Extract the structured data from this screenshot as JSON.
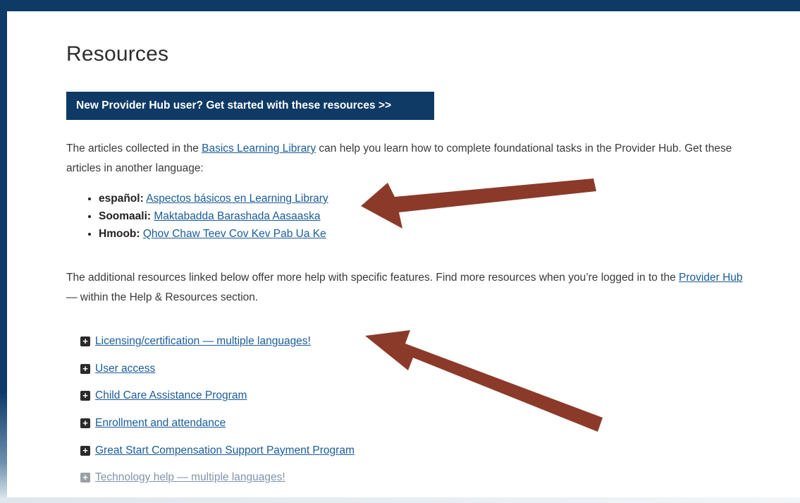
{
  "page": {
    "title": "Resources",
    "cta_label": "New Provider Hub user? Get started with these resources >>"
  },
  "intro": {
    "before_link": "The articles collected in the ",
    "link_text": "Basics Learning Library",
    "after_link": " can help you learn how to complete foundational tasks in the Provider Hub. Get these articles in another language:"
  },
  "languages": [
    {
      "lang": "español:",
      "link": "Aspectos básicos en Learning Library"
    },
    {
      "lang": "Soomaali:",
      "link": "Maktabadda Barashada Aasaaska"
    },
    {
      "lang": "Hmoob:",
      "link": "Qhov Chaw Teev Cov Kev Pab Ua Ke"
    }
  ],
  "additional": {
    "before_link": "The additional resources linked below offer more help with specific features. Find more resources when you’re logged in to the ",
    "link_text": "Provider Hub",
    "after_link": " — within the Help & Resources section."
  },
  "accordion": {
    "items": [
      {
        "label": " Licensing/certification — multiple languages!"
      },
      {
        "label": " User access"
      },
      {
        "label": " Child Care Assistance Program"
      },
      {
        "label": " Enrollment and attendance"
      },
      {
        "label": " Great Start Compensation Support Payment Program"
      },
      {
        "label": " Technology help — multiple languages!"
      }
    ]
  },
  "icons": {
    "expand": "plus-box-icon",
    "annotation": "arrow-icon"
  },
  "colors": {
    "brand": "#0f3a66",
    "link": "#1a5c9a",
    "arrow": "#8b3a2a"
  }
}
